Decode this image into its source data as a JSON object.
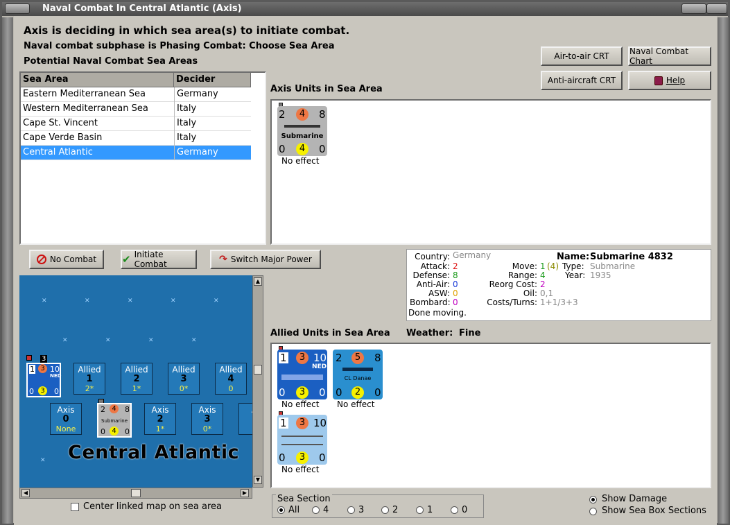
{
  "window": {
    "title": "Naval Combat In Central Atlantic (Axis)"
  },
  "header": {
    "line1": "Axis is deciding in which sea area(s) to initiate combat.",
    "line2": "Naval combat subphase is Phasing Combat: Choose Sea Area",
    "line3": "Potential Naval Combat Sea Areas"
  },
  "buttons": {
    "air_to_air": "Air-to-air CRT",
    "naval_chart": "Naval Combat Chart",
    "anti_aircraft": "Anti-aircraft CRT",
    "help": "Help",
    "no_combat": "No Combat",
    "initiate": "Initiate Combat",
    "switch": "Switch Major Power"
  },
  "sea_table": {
    "col1": "Sea Area",
    "col2": "Decider",
    "rows": [
      {
        "area": "Eastern Mediterranean Sea",
        "decider": "Germany"
      },
      {
        "area": "Western Mediterranean Sea",
        "decider": "Italy"
      },
      {
        "area": "Cape St. Vincent",
        "decider": "Italy"
      },
      {
        "area": "Cape Verde Basin",
        "decider": "Italy"
      },
      {
        "area": "Central Atlantic",
        "decider": "Germany"
      }
    ]
  },
  "axis_units": {
    "label": "Axis Units in Sea Area",
    "unit": {
      "tl": "2",
      "tc": "4",
      "tr": "8",
      "name": "Submarine",
      "bl": "0",
      "bc": "4",
      "br": "0",
      "status": "No effect"
    }
  },
  "info": {
    "country_k": "Country:",
    "country_v": "Germany",
    "attack_k": "Attack:",
    "attack_v": "2",
    "defense_k": "Defense:",
    "defense_v": "8",
    "antiair_k": "Anti-Air:",
    "antiair_v": "0",
    "asw_k": "ASW:",
    "asw_v": "0",
    "bombard_k": "Bombard:",
    "bombard_v": "0",
    "done": "Done moving.",
    "move_k": "Move:",
    "move_v": "1",
    "move_v2": "(4)",
    "range_k": "Range:",
    "range_v": "4",
    "reorg_k": "Reorg Cost:",
    "reorg_v": "2",
    "oil_k": "Oil:",
    "oil_v": "0,1",
    "costs_k": "Costs/Turns:",
    "costs_v": "1+1/3+3",
    "name_k": "Name:",
    "name_v": "Submarine 4832",
    "type_k": "Type:",
    "type_v": "Submarine",
    "year_k": "Year:",
    "year_v": "1935"
  },
  "allied": {
    "label": "Allied Units in Sea Area",
    "weather_label": "Weather:",
    "weather": "Fine",
    "units": [
      {
        "tl": "1",
        "tc": "3",
        "tr": "10",
        "tag": "NED",
        "bl": "0",
        "bc": "3",
        "br": "0",
        "status": "No effect"
      },
      {
        "tl": "2",
        "tc": "5",
        "tr": "8",
        "name": "CL Danae",
        "bl": "0",
        "bc": "2",
        "br": "0",
        "status": "No effect"
      },
      {
        "tl": "1",
        "tc": "3",
        "tr": "10",
        "bl": "0",
        "bc": "3",
        "br": "0",
        "status": "No effect"
      }
    ]
  },
  "map": {
    "name": "Central Atlantic",
    "stack_count": "3",
    "allied_boxes": [
      {
        "label": "Allied",
        "num": "1",
        "sub": "2*"
      },
      {
        "label": "Allied",
        "num": "2",
        "sub": "1*"
      },
      {
        "label": "Allied",
        "num": "3",
        "sub": "0*"
      },
      {
        "label": "Allied",
        "num": "4",
        "sub": "0"
      }
    ],
    "axis_boxes": [
      {
        "label": "Axis",
        "num": "0",
        "sub": "None"
      },
      {
        "label": "Axis",
        "num": "2",
        "sub": "1*"
      },
      {
        "label": "Axis",
        "num": "3",
        "sub": "0*"
      },
      {
        "label": "A",
        "num": "",
        "sub": ""
      }
    ],
    "mini_ned": {
      "tl": "1",
      "tc": "3",
      "tr": "10",
      "tag": "NED",
      "bl": "0",
      "bc": "3",
      "br": "0"
    },
    "mini_sub": {
      "tl": "2",
      "tc": "4",
      "tr": "8",
      "name": "Submarine",
      "bl": "0",
      "bc": "4",
      "br": "0"
    }
  },
  "center_checkbox": "Center linked map on sea area",
  "sea_section": {
    "label": "Sea Section",
    "options": [
      "All",
      "4",
      "3",
      "2",
      "1",
      "0"
    ]
  },
  "options": {
    "show_damage": "Show Damage",
    "show_sections": "Show Sea Box Sections"
  },
  "colors": {
    "attack_circle": "#ee7744",
    "defense_circle": "#f6f000",
    "selection": "#3399ff",
    "map_sea": "#1f6fab"
  }
}
